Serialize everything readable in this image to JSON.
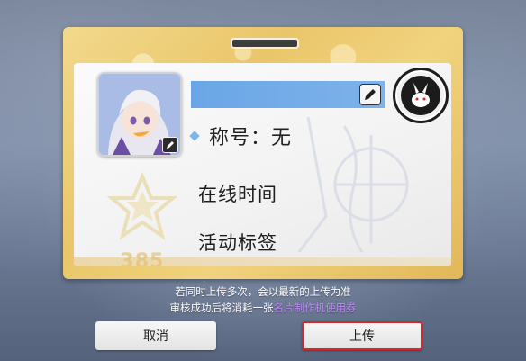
{
  "profile_card": {
    "title_label": "称号：无",
    "online_time_label": "在线时间",
    "activity_tags_label": "活动标签",
    "level": "385"
  },
  "notice": {
    "line1": "若同时上传多次，会以最新的上传为准",
    "line2_prefix": "审核成功后将消耗一张",
    "line2_link": "名片制作机使用券"
  },
  "buttons": {
    "cancel": "取消",
    "upload": "上传"
  },
  "icons": {
    "avatar_edit": "pencil-icon",
    "name_edit": "pencil-icon",
    "emblem": "rabbit-emblem-icon",
    "title_bullet": "diamond-icon",
    "level_badge": "star-icon"
  },
  "colors": {
    "name_bar": "#6aa6e6",
    "card_gold": "#e9c66a",
    "upload_highlight": "#d8262c",
    "link_purple": "#b98cf0",
    "level_text": "#e6cf9c"
  }
}
